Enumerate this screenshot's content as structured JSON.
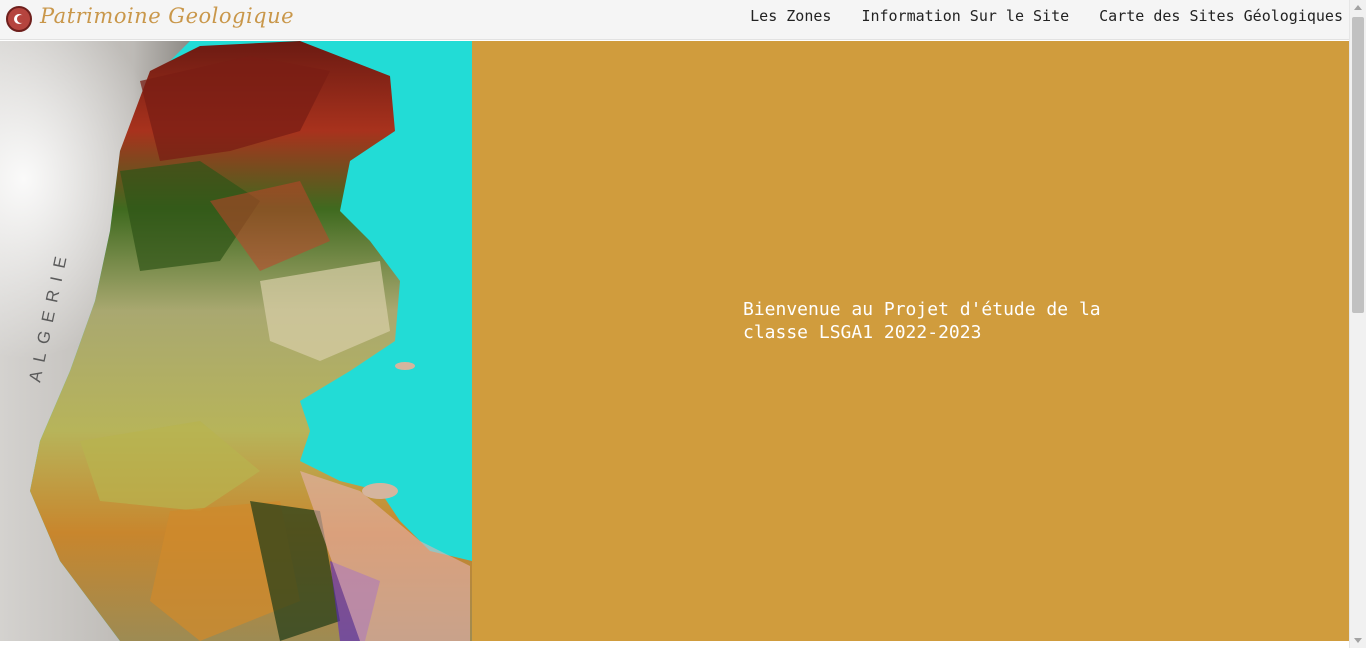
{
  "header": {
    "brand": "Patrimoine Geologique",
    "nav": [
      {
        "label": "Les Zones"
      },
      {
        "label": "Information Sur le Site"
      },
      {
        "label": "Carte des Sites Géologiques"
      }
    ]
  },
  "hero": {
    "map_label": "ALGERIE",
    "welcome": "Bienvenue au Projet d'étude de la classe LSGA1 2022-2023"
  },
  "colors": {
    "panel": "#d09c3d",
    "sea": "#22dcd6",
    "brand": "#c9974a",
    "logo": "#b5443e"
  },
  "icons": {
    "logo": "flag-crescent-icon"
  }
}
